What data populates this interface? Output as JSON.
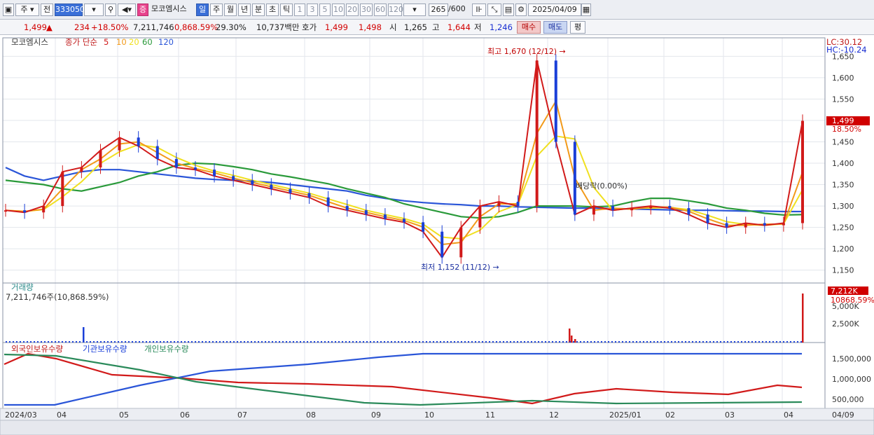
{
  "toolbar": {
    "market": "주",
    "prev_label": "전",
    "code": "333050",
    "stock_name": "모코엠시스",
    "badge": "증",
    "periods": [
      "일",
      "주",
      "월",
      "년",
      "분",
      "초",
      "틱"
    ],
    "active_period": "일",
    "intervals": [
      "1",
      "3",
      "5",
      "10",
      "20",
      "30",
      "60",
      "120"
    ],
    "count": "265",
    "total": "/600",
    "date": "2025/04/09"
  },
  "quote": {
    "price": "1,499",
    "arrow": "▲",
    "change": "234",
    "change_pct": "+18.50%",
    "volume": "7,211,746",
    "vol_ratio": "0,868.59%",
    "turnover": "29.30%",
    "amount": "10,737백만",
    "bid_label": "호가",
    "bid": "1,499",
    "ask": "1,498",
    "open_label": "시",
    "open": "1,265",
    "high_label": "고",
    "high": "1,644",
    "low_label": "저",
    "low": "1,246",
    "buy_btn": "매수",
    "sell_btn": "매도",
    "eval_btn": "평"
  },
  "price_panel": {
    "title": "모코엠시스",
    "indicator": "종가 단순",
    "ma_periods": [
      "5",
      "10",
      "20",
      "60",
      "120"
    ],
    "ma_colors": [
      "#d11a1a",
      "#f29a1a",
      "#f0e020",
      "#2a9a3a",
      "#2a55d8"
    ],
    "lc": "LC:30.12",
    "hc": "HC:-10.24",
    "high_annotation": "최고 1,670 (12/12)",
    "low_annotation": "최저 1,152 (11/12)",
    "dividend_annotation": "배당락(0.00%)",
    "current_price_label": "1,499",
    "current_pct_label": "18.50%"
  },
  "volume_panel": {
    "title": "거래량",
    "value": "7,211,746주(10,868.59%)",
    "current_label": "7,212K",
    "pct_label": "10868.59%"
  },
  "holding_panel": {
    "foreign": "외국인보유수량",
    "inst": "기관보유수량",
    "indiv": "개인보유수량"
  },
  "chart_data": {
    "type": "line",
    "price_axis": {
      "ticks": [
        1650,
        1600,
        1550,
        1500,
        1450,
        1400,
        1350,
        1300,
        1250,
        1200,
        1150
      ],
      "range": [
        1120,
        1680
      ]
    },
    "volume_axis": {
      "ticks": [
        "5,000K",
        "2,500K"
      ]
    },
    "holding_axis": {
      "ticks": [
        "1,500,000",
        "1,000,000",
        "500,000"
      ]
    },
    "x_labels": [
      "2024/03",
      "04",
      "05",
      "06",
      "07",
      "08",
      "09",
      "10",
      "11",
      "12",
      "2025/01",
      "02",
      "03",
      "04",
      "04/09"
    ],
    "close_series": [
      1290,
      1285,
      1300,
      1380,
      1390,
      1430,
      1460,
      1440,
      1410,
      1390,
      1385,
      1370,
      1360,
      1350,
      1340,
      1330,
      1320,
      1300,
      1290,
      1280,
      1270,
      1262,
      1240,
      1180,
      1250,
      1300,
      1310,
      1300,
      1640,
      1450,
      1280,
      1300,
      1290,
      1295,
      1300,
      1295,
      1280,
      1260,
      1250,
      1260,
      1255,
      1260,
      1499
    ],
    "ma120_series": [
      1390,
      1370,
      1360,
      1370,
      1380,
      1385,
      1385,
      1380,
      1375,
      1370,
      1365,
      1362,
      1360,
      1358,
      1355,
      1350,
      1345,
      1340,
      1335,
      1325,
      1318,
      1312,
      1308,
      1305,
      1303,
      1300,
      1300,
      1298,
      1297,
      1296,
      1295,
      1295,
      1294,
      1293,
      1292,
      1291,
      1290,
      1290,
      1289,
      1288,
      1288,
      1287,
      1287
    ],
    "ma60_series": [
      1360,
      1355,
      1350,
      1340,
      1335,
      1345,
      1355,
      1370,
      1380,
      1395,
      1400,
      1398,
      1392,
      1385,
      1375,
      1368,
      1360,
      1352,
      1340,
      1330,
      1320,
      1305,
      1295,
      1285,
      1275,
      1272,
      1275,
      1285,
      1300,
      1300,
      1300,
      1298,
      1300,
      1310,
      1318,
      1318,
      1312,
      1305,
      1295,
      1290,
      1283,
      1279,
      1280
    ]
  }
}
